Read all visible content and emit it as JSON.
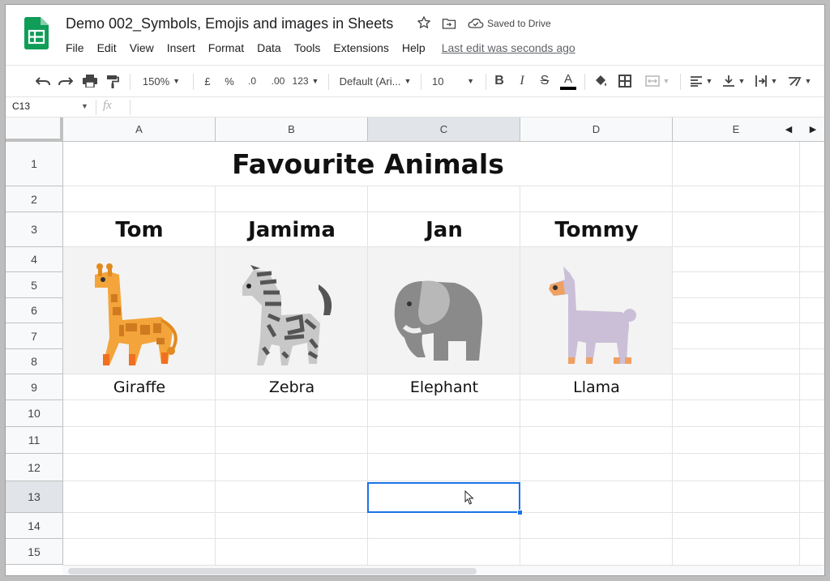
{
  "app": {
    "doc_title": "Demo 002_Symbols, Emojis and images in Sheets",
    "saved_status": "Saved to Drive",
    "last_edit": "Last edit was seconds ago"
  },
  "menu": [
    "File",
    "Edit",
    "View",
    "Insert",
    "Format",
    "Data",
    "Tools",
    "Extensions",
    "Help"
  ],
  "toolbar": {
    "zoom": "150%",
    "currency": "£",
    "percent": "%",
    "decimal_decrease": ".0",
    "decimal_increase": ".00",
    "more_formats": "123",
    "font": "Default (Ari...",
    "font_size": "10",
    "bold": "B",
    "italic": "I",
    "strike": "S",
    "text_color": "A"
  },
  "formula_bar": {
    "cell_ref": "C13",
    "fx": "fx",
    "content": ""
  },
  "columns": [
    "A",
    "B",
    "C",
    "D",
    "E"
  ],
  "rows": [
    "1",
    "2",
    "3",
    "4",
    "5",
    "6",
    "7",
    "8",
    "9",
    "10",
    "11",
    "12",
    "13",
    "14",
    "15"
  ],
  "sheet": {
    "title": "Favourite Animals",
    "people": [
      "Tom",
      "Jamima",
      "Jan",
      "Tommy"
    ],
    "animals": [
      {
        "label": "Giraffe",
        "icon": "giraffe-icon"
      },
      {
        "label": "Zebra",
        "icon": "zebra-icon"
      },
      {
        "label": "Elephant",
        "icon": "elephant-icon"
      },
      {
        "label": "Llama",
        "icon": "llama-icon"
      }
    ]
  },
  "selection": {
    "cell": "C13"
  },
  "colors": {
    "accent": "#1a73e8",
    "sheets_green": "#0f9d58",
    "header_bg": "#f8f9fa",
    "selected_header_bg": "#e1e4e8",
    "image_band_bg": "#f3f3f3"
  }
}
